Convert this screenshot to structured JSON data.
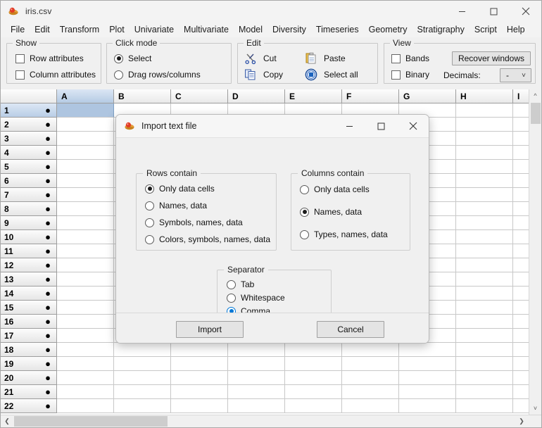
{
  "window": {
    "title": "iris.csv",
    "icon": "past-app-icon",
    "controls": {
      "minimize": "minimize-icon",
      "maximize": "maximize-icon",
      "close": "close-icon"
    }
  },
  "menubar": {
    "items": [
      {
        "label": "File"
      },
      {
        "label": "Edit"
      },
      {
        "label": "Transform"
      },
      {
        "label": "Plot"
      },
      {
        "label": "Univariate"
      },
      {
        "label": "Multivariate"
      },
      {
        "label": "Model"
      },
      {
        "label": "Diversity"
      },
      {
        "label": "Timeseries"
      },
      {
        "label": "Geometry"
      },
      {
        "label": "Stratigraphy"
      },
      {
        "label": "Script"
      },
      {
        "label": "Help"
      }
    ]
  },
  "ribbon": {
    "show": {
      "title": "Show",
      "checkboxes": [
        {
          "label": "Row attributes",
          "checked": false
        },
        {
          "label": "Column attributes",
          "checked": false
        }
      ]
    },
    "click_mode": {
      "title": "Click mode",
      "options": [
        {
          "label": "Select",
          "checked": true
        },
        {
          "label": "Drag rows/columns",
          "checked": false
        }
      ]
    },
    "edit": {
      "title": "Edit",
      "commands": [
        {
          "label": "Cut",
          "icon": "scissors-icon"
        },
        {
          "label": "Copy",
          "icon": "copy-icon"
        },
        {
          "label": "Paste",
          "icon": "clipboard-icon"
        },
        {
          "label": "Select all",
          "icon": "select-all-icon"
        }
      ]
    },
    "view": {
      "title": "View",
      "checkboxes": [
        {
          "label": "Bands",
          "checked": false
        },
        {
          "label": "Binary",
          "checked": false
        }
      ],
      "recover_button": "Recover windows",
      "decimals_label": "Decimals:",
      "decimals_value": "-"
    }
  },
  "sheet": {
    "columns": [
      "A",
      "B",
      "C",
      "D",
      "E",
      "F",
      "G",
      "H",
      "I"
    ],
    "selected_column": "A",
    "rows": [
      "1",
      "2",
      "3",
      "4",
      "5",
      "6",
      "7",
      "8",
      "9",
      "10",
      "11",
      "12",
      "13",
      "14",
      "15",
      "16",
      "17",
      "18",
      "19",
      "20",
      "21",
      "22"
    ],
    "selected_row": "1",
    "row_marker": "●",
    "cell_values": []
  },
  "dialog": {
    "title": "Import text file",
    "icon": "past-app-icon",
    "controls": {
      "minimize": "minimize-icon",
      "maximize": "maximize-icon",
      "close": "close-icon"
    },
    "rows_contain": {
      "title": "Rows contain",
      "options": [
        {
          "label": "Only data cells",
          "checked": true
        },
        {
          "label": "Names, data",
          "checked": false
        },
        {
          "label": "Symbols, names, data",
          "checked": false
        },
        {
          "label": "Colors, symbols, names, data",
          "checked": false
        }
      ]
    },
    "columns_contain": {
      "title": "Columns contain",
      "options": [
        {
          "label": "Only data cells",
          "checked": false
        },
        {
          "label": "Names, data",
          "checked": true
        },
        {
          "label": "Types, names, data",
          "checked": false
        }
      ]
    },
    "separator": {
      "title": "Separator",
      "options": [
        {
          "label": "Tab",
          "checked": false
        },
        {
          "label": "Whitespace",
          "checked": false
        },
        {
          "label": "Comma",
          "checked": true,
          "accent": true
        }
      ]
    },
    "buttons": {
      "import": "Import",
      "cancel": "Cancel"
    }
  },
  "colors": {
    "accent": "#0078d7",
    "selection": "#aec5e0",
    "chrome": "#f0f0f0"
  }
}
